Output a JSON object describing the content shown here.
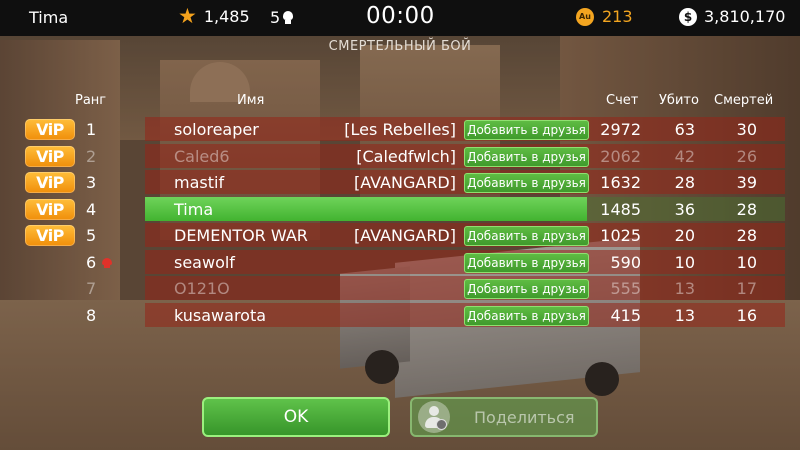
{
  "topbar": {
    "player_name": "Tima",
    "rating": "1,485",
    "kills": "5",
    "timer": "00:00",
    "gold_icon_label": "Au",
    "gold": "213",
    "money_icon_label": "$",
    "money": "3,810,170",
    "icons": {
      "rating": "star-icon",
      "kills": "skull-icon",
      "gold": "gold-coin-icon",
      "money": "dollar-coin-icon"
    }
  },
  "mode_title": "СМЕРТЕЛЬНЫЙ БОЙ",
  "headers": {
    "rank": "Ранг",
    "name": "Имя",
    "score": "Счет",
    "kills": "Убито",
    "deaths": "Смертей"
  },
  "vip_label": "ViP",
  "add_friend_label": "Добавить в друзья",
  "rows": [
    {
      "rank": "1",
      "name": "soloreaper",
      "clan": "[Les Rebelles]",
      "score": "2972",
      "kills": "63",
      "deaths": "30"
    },
    {
      "rank": "2",
      "name": "Caled6",
      "clan": "[Caledfwlch]",
      "score": "2062",
      "kills": "42",
      "deaths": "26"
    },
    {
      "rank": "3",
      "name": "mastif",
      "clan": "[AVANGARD]",
      "score": "1632",
      "kills": "28",
      "deaths": "39"
    },
    {
      "rank": "4",
      "name": "Tima",
      "clan": "",
      "score": "1485",
      "kills": "36",
      "deaths": "28"
    },
    {
      "rank": "5",
      "name": "DEMENTOR WAR",
      "clan": "[AVANGARD]",
      "score": "1025",
      "kills": "20",
      "deaths": "28"
    },
    {
      "rank": "6",
      "name": "seawolf",
      "clan": "",
      "score": "590",
      "kills": "10",
      "deaths": "10"
    },
    {
      "rank": "7",
      "name": "O121O",
      "clan": "",
      "score": "555",
      "kills": "13",
      "deaths": "17"
    },
    {
      "rank": "8",
      "name": "kusawarota",
      "clan": "",
      "score": "415",
      "kills": "13",
      "deaths": "16"
    }
  ],
  "buttons": {
    "ok": "OK",
    "share": "Поделиться"
  },
  "colors": {
    "accent_green": "#42b330",
    "vip_orange": "#f08e0a",
    "gold": "#f3a520",
    "row_red": "#962418"
  }
}
